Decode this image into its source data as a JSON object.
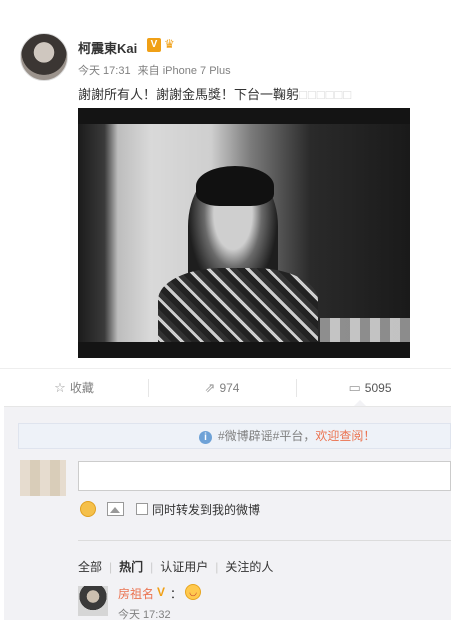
{
  "post": {
    "author": "柯震東Kai",
    "verified_badge": "V",
    "time": "今天 17:31",
    "source": "来自 iPhone 7 Plus",
    "text": "謝謝所有人！謝謝金馬獎！下台一鞠躬",
    "trailing_boxes": "□□□□□□"
  },
  "actions": {
    "favorite_label": "收藏",
    "forward_count": "974",
    "comment_count": "5095"
  },
  "notice": {
    "prefix": "#微博辟谣#平台，",
    "link_text": "欢迎查阅！"
  },
  "composer": {
    "input_value": "",
    "repost_checkbox_label": "同时转发到我的微博"
  },
  "filters": {
    "items": [
      "全部",
      "热门",
      "认证用户",
      "关注的人"
    ],
    "active": "热门"
  },
  "comment": {
    "user": "房祖名",
    "badge": "V",
    "colon": "：",
    "time": "今天 17:32"
  },
  "colors": {
    "accent": "#eb7350",
    "badge": "#f0a016",
    "muted": "#808080"
  },
  "icons": [
    "star-icon",
    "forward-icon",
    "comment-icon",
    "info-icon",
    "emoji-icon",
    "image-icon",
    "crown-icon"
  ]
}
